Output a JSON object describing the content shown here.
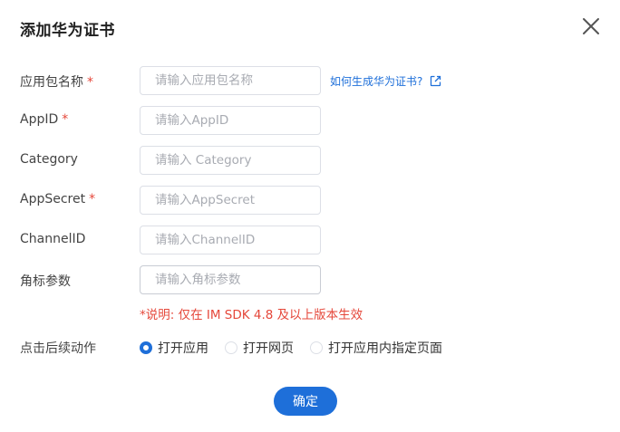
{
  "dialog": {
    "title": "添加华为证书"
  },
  "fields": [
    {
      "label": "应用包名称",
      "required": true,
      "placeholder": "请输入应用包名称",
      "value": ""
    },
    {
      "label": "AppID",
      "required": true,
      "placeholder": "请输入AppID",
      "value": ""
    },
    {
      "label": "Category",
      "required": false,
      "placeholder": "请输入 Category",
      "value": ""
    },
    {
      "label": "AppSecret",
      "required": true,
      "placeholder": "请输入AppSecret",
      "value": ""
    },
    {
      "label": "ChannelID",
      "required": false,
      "placeholder": "请输入ChannelID",
      "value": ""
    },
    {
      "label": "角标参数",
      "required": false,
      "placeholder": "请输入角标参数",
      "value": ""
    }
  ],
  "required_mark": "*",
  "help_link": {
    "text": "如何生成华为证书?",
    "icon": "external-link-icon"
  },
  "note": "*说明: 仅在 IM SDK 4.8 及以上版本生效",
  "click_action": {
    "label": "点击后续动作",
    "options": [
      "打开应用",
      "打开网页",
      "打开应用内指定页面"
    ],
    "selected": "打开应用"
  },
  "confirm_button": {
    "label": "确定"
  },
  "colors": {
    "accent": "#1e6fd9",
    "required": "#e5473a"
  },
  "icons": {
    "close": "close-icon",
    "external": "external-link-icon"
  }
}
